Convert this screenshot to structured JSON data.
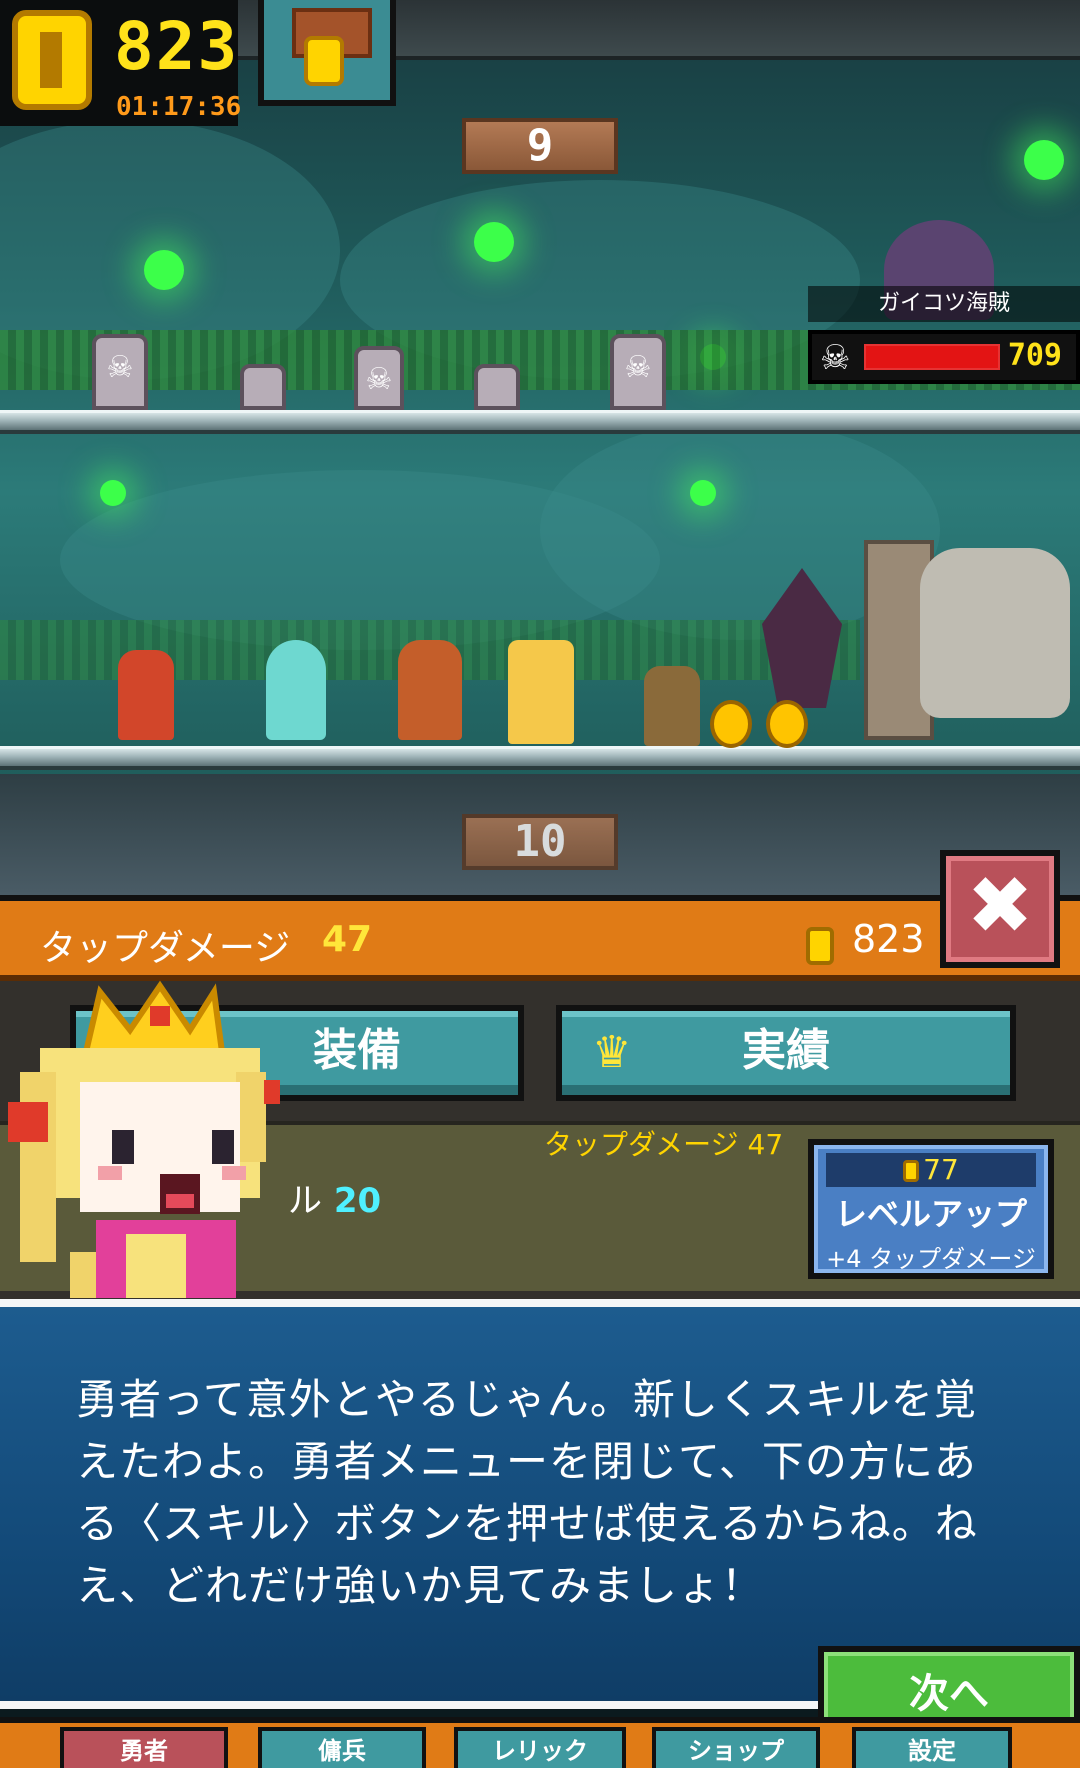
{
  "hud": {
    "gold": "823",
    "timer": "01:17:36"
  },
  "stage": {
    "current_floor": "9",
    "next_floor": "10"
  },
  "enemy": {
    "name": "ガイコツ海賊",
    "hp": "709",
    "hp_fraction": 0.6
  },
  "stats": {
    "tap_damage_label": "タップダメージ",
    "tap_damage_value": "47",
    "gold": "823"
  },
  "menu": {
    "tab_equipment": "装備",
    "tab_achievements": "実績",
    "hero_row_tap": "タップダメージ 47",
    "hero_row_level_fragment": "ル",
    "hero_row_level_value": "20",
    "levelup": {
      "cost": "77",
      "title": "レベルアップ",
      "sub": "+4 タップダメージ"
    }
  },
  "dialog": {
    "text": "勇者って意外とやるじゃん。新しくスキルを覚えたわよ。勇者メニューを閉じて、下の方にある〈スキル〉ボタンを押せば使えるからね。ねえ、どれだけ強いか見てみましょ！",
    "next_label": "次へ"
  },
  "nav": {
    "items": [
      "勇者",
      "傭兵",
      "レリック",
      "ショップ",
      "設定"
    ]
  },
  "colors": {
    "accent_orange": "#e07b16",
    "close_red": "#b9515a",
    "button_teal": "#3f9aa0",
    "next_green": "#4cbc3c",
    "dialog_blue": "#134a79"
  }
}
